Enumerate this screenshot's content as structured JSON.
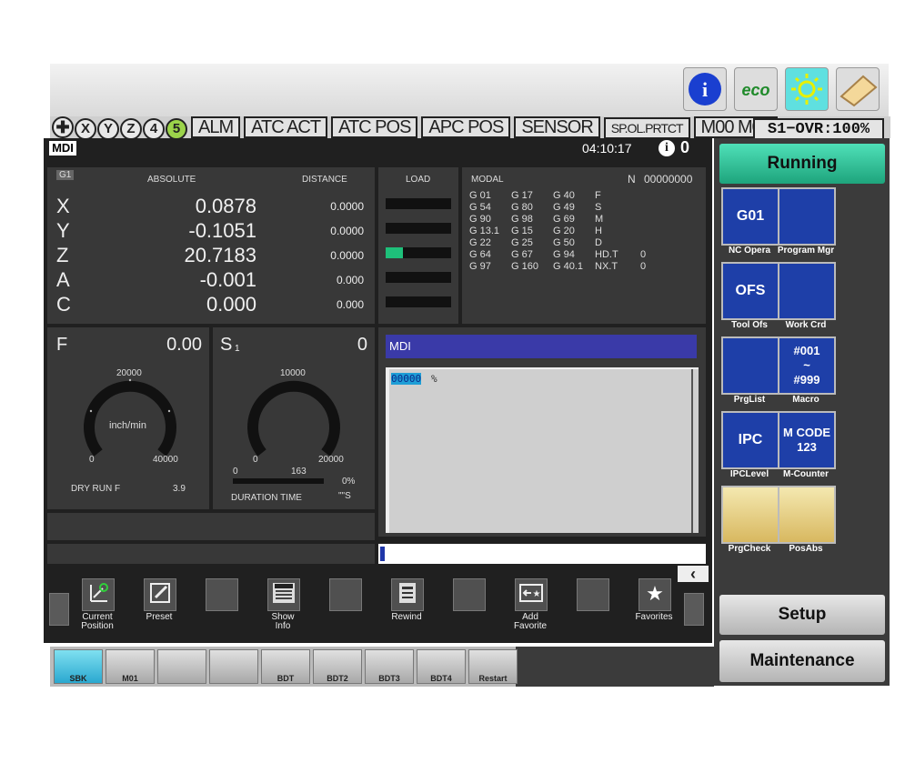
{
  "header": {
    "axis_indicators": [
      "X",
      "Y",
      "Z",
      "4",
      "5"
    ],
    "status_boxes": [
      "ALM",
      "ATC ACT",
      "ATC POS",
      "APC POS",
      "SENSOR",
      "SP.OL.PRTCT",
      "M00 M01"
    ],
    "override": "S1−OVR:100%",
    "icons": [
      "info-icon",
      "eco-icon",
      "light-icon",
      "eraser-icon"
    ]
  },
  "mode_bar": {
    "mode": "MDI",
    "time": "04:10:17",
    "alarm_count": "0"
  },
  "position": {
    "group": "G1",
    "absolute_header": "ABSOLUTE",
    "distance_header": "DISTANCE",
    "load_header": "LOAD",
    "axes": [
      {
        "name": "X",
        "absolute": "0.0878",
        "distance": "0.0000",
        "load": 0
      },
      {
        "name": "Y",
        "absolute": "-0.1051",
        "distance": "0.0000",
        "load": 0
      },
      {
        "name": "Z",
        "absolute": "20.7183",
        "distance": "0.0000",
        "load": 0.26
      },
      {
        "name": "A",
        "absolute": "-0.001",
        "distance": "0.000",
        "load": 0
      },
      {
        "name": "C",
        "absolute": "0.000",
        "distance": "0.000",
        "load": 0
      }
    ]
  },
  "modal": {
    "header": "MODAL",
    "n_label": "N",
    "n_value": "00000000",
    "rows": [
      [
        "G 01",
        "G 17",
        "G 40",
        "F",
        ""
      ],
      [
        "G 54",
        "G 80",
        "G 49",
        "S",
        ""
      ],
      [
        "G 90",
        "G 98",
        "G 69",
        "M",
        ""
      ],
      [
        "G 13.1",
        "G 15",
        "G 20",
        "H",
        ""
      ],
      [
        "G 22",
        "G 25",
        "G 50",
        "D",
        ""
      ],
      [
        "G 64",
        "G 67",
        "G 94",
        "HD.T",
        "0"
      ],
      [
        "G 97",
        "G 160",
        "G 40.1",
        "NX.T",
        "0"
      ]
    ]
  },
  "feed": {
    "label": "F",
    "value": "0.00",
    "max": "20000",
    "min": "0",
    "right": "40000",
    "unit": "inch/min",
    "dry_run_label": "DRY RUN F",
    "dry_run_value": "3.9"
  },
  "spindle": {
    "label": "S",
    "sub": "1",
    "value": "0",
    "max": "10000",
    "min": "0",
    "right": "20000",
    "bar_min": "0",
    "bar_value": "163",
    "percent": "0%",
    "duration_label": "DURATION TIME",
    "duration_value": "\"\"S"
  },
  "mdi": {
    "title": "MDI",
    "program": "00000",
    "symbol": "%"
  },
  "toolbar": [
    {
      "label": "Current\nPosition",
      "icon": "current-position-icon"
    },
    {
      "label": "Preset",
      "icon": "preset-icon"
    },
    {
      "label": "",
      "icon": ""
    },
    {
      "label": "Show\nInfo",
      "icon": "show-info-icon",
      "icon_text": "MODAL"
    },
    {
      "label": "",
      "icon": ""
    },
    {
      "label": "Rewind",
      "icon": "rewind-icon"
    },
    {
      "label": "",
      "icon": ""
    },
    {
      "label": "Add\nFavorite",
      "icon": "add-favorite-icon"
    },
    {
      "label": "",
      "icon": ""
    },
    {
      "label": "Favorites",
      "icon": "favorites-icon"
    }
  ],
  "softkeys": [
    "SBK",
    "M01",
    "",
    "",
    "BDT",
    "BDT2",
    "BDT3",
    "BDT4",
    "Restart"
  ],
  "right": {
    "running": "Running",
    "functions": [
      {
        "label": "NC Opera",
        "icon_text": "G01"
      },
      {
        "label": "Program Mgr",
        "icon_text": ""
      },
      {
        "label": "Tool Ofs",
        "icon_text": "OFS"
      },
      {
        "label": "Work Crd",
        "icon_text": ""
      },
      {
        "label": "PrgList",
        "icon_text": ""
      },
      {
        "label": "Macro",
        "icon_text": "#001\n~\n#999"
      },
      {
        "label": "IPCLevel",
        "icon_text": "IPC"
      },
      {
        "label": "M-Counter",
        "icon_text": "M CODE\n123"
      },
      {
        "label": "PrgCheck",
        "icon_text": ""
      },
      {
        "label": "PosAbs",
        "icon_text": ""
      }
    ],
    "setup": "Setup",
    "maintenance": "Maintenance"
  }
}
